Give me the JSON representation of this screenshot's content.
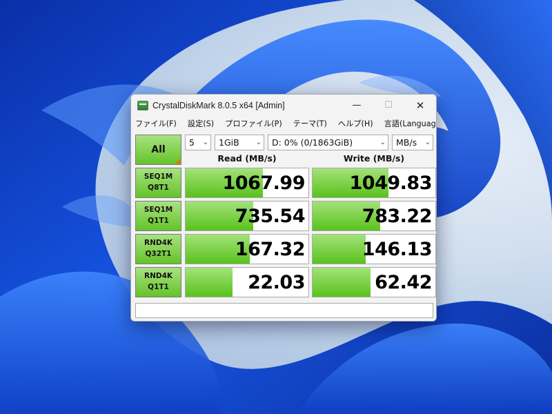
{
  "window": {
    "title": "CrystalDiskMark 8.0.5 x64 [Admin]",
    "controls": {
      "minimize": "—",
      "maximize": "☐",
      "close": "✕"
    }
  },
  "menu": [
    "ファイル(F)",
    "設定(S)",
    "プロファイル(P)",
    "テーマ(T)",
    "ヘルプ(H)",
    "言語(Language)"
  ],
  "toolbar": {
    "all_label": "All",
    "count": "5",
    "size": "1GiB",
    "drive": "D: 0% (0/1863GiB)",
    "unit": "MB/s"
  },
  "headers": {
    "read": "Read (MB/s)",
    "write": "Write (MB/s)"
  },
  "rows": [
    {
      "line1": "SEQ1M",
      "line2": "Q8T1",
      "read": "1067.99",
      "write": "1049.83",
      "read_fill": 0.63,
      "write_fill": 0.62
    },
    {
      "line1": "SEQ1M",
      "line2": "Q1T1",
      "read": "735.54",
      "write": "783.22",
      "read_fill": 0.55,
      "write_fill": 0.55
    },
    {
      "line1": "RND4K",
      "line2": "Q32T1",
      "read": "167.32",
      "write": "146.13",
      "read_fill": 0.52,
      "write_fill": 0.43
    },
    {
      "line1": "RND4K",
      "line2": "Q1T1",
      "read": "22.03",
      "write": "62.42",
      "read_fill": 0.38,
      "write_fill": 0.47
    }
  ],
  "comment": "",
  "colors": {
    "accent_green": "#64c329",
    "bar_green": "#59c21b",
    "corner_orange": "#ff6a00"
  }
}
